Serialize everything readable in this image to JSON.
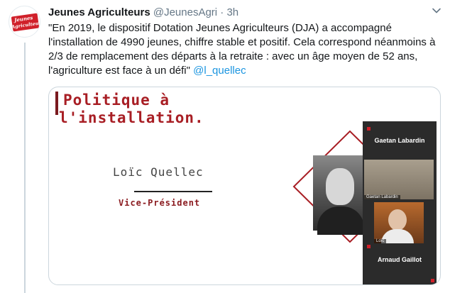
{
  "account": {
    "display_name": "Jeunes Agriculteurs",
    "handle": "@JeunesAgri",
    "separator": "·",
    "time": "3h",
    "avatar_logo_line1": "Jeunes",
    "avatar_logo_line2": "Agriculteurs"
  },
  "tweet": {
    "text": "\"En 2019, le dispositif Dotation Jeunes Agriculteurs (DJA) a accompagné l'installation de 4990 jeunes, chiffre stable et positif. Cela correspond néanmoins à 2/3 de remplacement des départs à la retraite : avec un âge moyen de 52 ans, l'agriculture est face à un défi\" ",
    "mention": "@l_quellec"
  },
  "media": {
    "slide_title_line1": "Politique à",
    "slide_title_line2": "l'installation.",
    "speaker_name": "Loïc Quellec",
    "speaker_role": "Vice-Président",
    "participants": {
      "top_name": "Gaetan Labardin",
      "top_cam_caption": "Gaetan Labardin",
      "bottom_name": "Arnaud Gaillot",
      "bottom_cam_caption": "Loïc"
    }
  },
  "colors": {
    "accent_red": "#a81e24",
    "link_blue": "#1b95e0",
    "muted_gray": "#657786"
  },
  "icons": {
    "chevron": "chevron-down-icon",
    "mute": "mic-muted-icon"
  }
}
